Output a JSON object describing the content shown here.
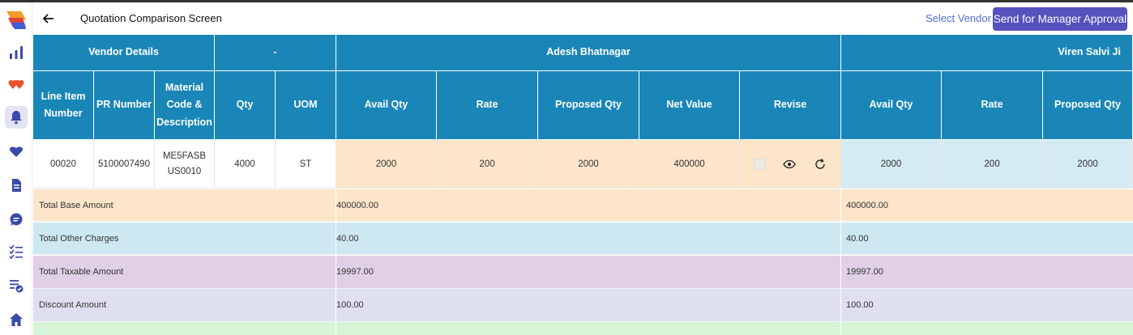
{
  "header": {
    "title": "Quotation Comparison Screen",
    "select_vendor": "Select Vendor",
    "approve_button": "Send for Manager Approval"
  },
  "sidebar": {
    "icons": [
      "bar-chart-icon",
      "hearts-icon",
      "bell-icon",
      "heart-icon",
      "document-icon",
      "chat-icon",
      "checklist-icon",
      "task-approved-icon",
      "home-icon"
    ],
    "active": "bell-icon"
  },
  "table": {
    "group_headers": {
      "vendor_details": "Vendor Details",
      "dash": "-",
      "vendor1": "Adesh Bhatnagar",
      "vendor2": "Viren Salvi Ji"
    },
    "columns": {
      "line_item": "Line Item Number",
      "pr_number": "PR Number",
      "material": "Material Code & Description",
      "qty": "Qty",
      "uom": "UOM",
      "v1_avail": "Avail Qty",
      "v1_rate": "Rate",
      "v1_proposed": "Proposed Qty",
      "v1_net": "Net Value",
      "v1_revise": "Revise",
      "v2_avail": "Avail Qty",
      "v2_rate": "Rate",
      "v2_proposed": "Proposed Qty"
    },
    "row": {
      "line_item": "00020",
      "pr_number": "5100007490",
      "material": "ME5FASBUS0010",
      "qty": "4000",
      "uom": "ST",
      "v1_avail": "2000",
      "v1_rate": "200",
      "v1_proposed": "2000",
      "v1_net": "400000",
      "v2_avail": "2000",
      "v2_rate": "200",
      "v2_proposed": "2000"
    },
    "summary": [
      {
        "label": "Total Base Amount",
        "v1": "400000.00",
        "v2": "400000.00"
      },
      {
        "label": "Total Other Charges",
        "v1": "40.00",
        "v2": "40.00"
      },
      {
        "label": "Total Taxable Amount",
        "v1": "19997.00",
        "v2": "19997.00"
      },
      {
        "label": "Discount Amount",
        "v1": "100.00",
        "v2": "100.00"
      }
    ]
  },
  "colors": {
    "header_blue": "#1a86b8",
    "button_purple": "#5551bd",
    "peach": "#fde5c9",
    "light_blue": "#d4ebf3",
    "purple": "#e0cfe5",
    "lavender": "#dfe0ef",
    "green": "#d6f5d6"
  }
}
